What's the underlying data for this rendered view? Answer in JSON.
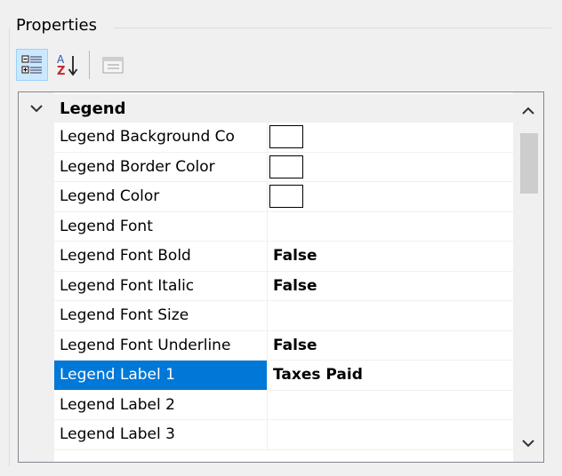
{
  "panel": {
    "title": "Properties"
  },
  "toolbar": {
    "buttons": [
      {
        "name": "categorized-icon",
        "active": true
      },
      {
        "name": "alphabetical-sort-icon",
        "active": false
      },
      {
        "name": "property-pages-icon",
        "active": false
      }
    ]
  },
  "grid": {
    "category": "Legend",
    "rows": [
      {
        "name": "Legend Background Co",
        "value": "",
        "swatch": true
      },
      {
        "name": "Legend Border Color",
        "value": "",
        "swatch": true
      },
      {
        "name": "Legend Color",
        "value": "",
        "swatch": true
      },
      {
        "name": "Legend Font",
        "value": "",
        "swatch": false
      },
      {
        "name": "Legend Font Bold",
        "value": "False",
        "swatch": false
      },
      {
        "name": "Legend Font Italic",
        "value": "False",
        "swatch": false
      },
      {
        "name": "Legend Font Size",
        "value": "",
        "swatch": false
      },
      {
        "name": "Legend Font Underline",
        "value": "False",
        "swatch": false
      },
      {
        "name": "Legend Label 1",
        "value": "Taxes Paid",
        "swatch": false,
        "selected": true
      },
      {
        "name": "Legend Label 2",
        "value": "",
        "swatch": false
      },
      {
        "name": "Legend Label 3",
        "value": "",
        "swatch": false
      }
    ]
  },
  "colors": {
    "selection": "#0078d7",
    "gutter": "#f0f0f0"
  }
}
